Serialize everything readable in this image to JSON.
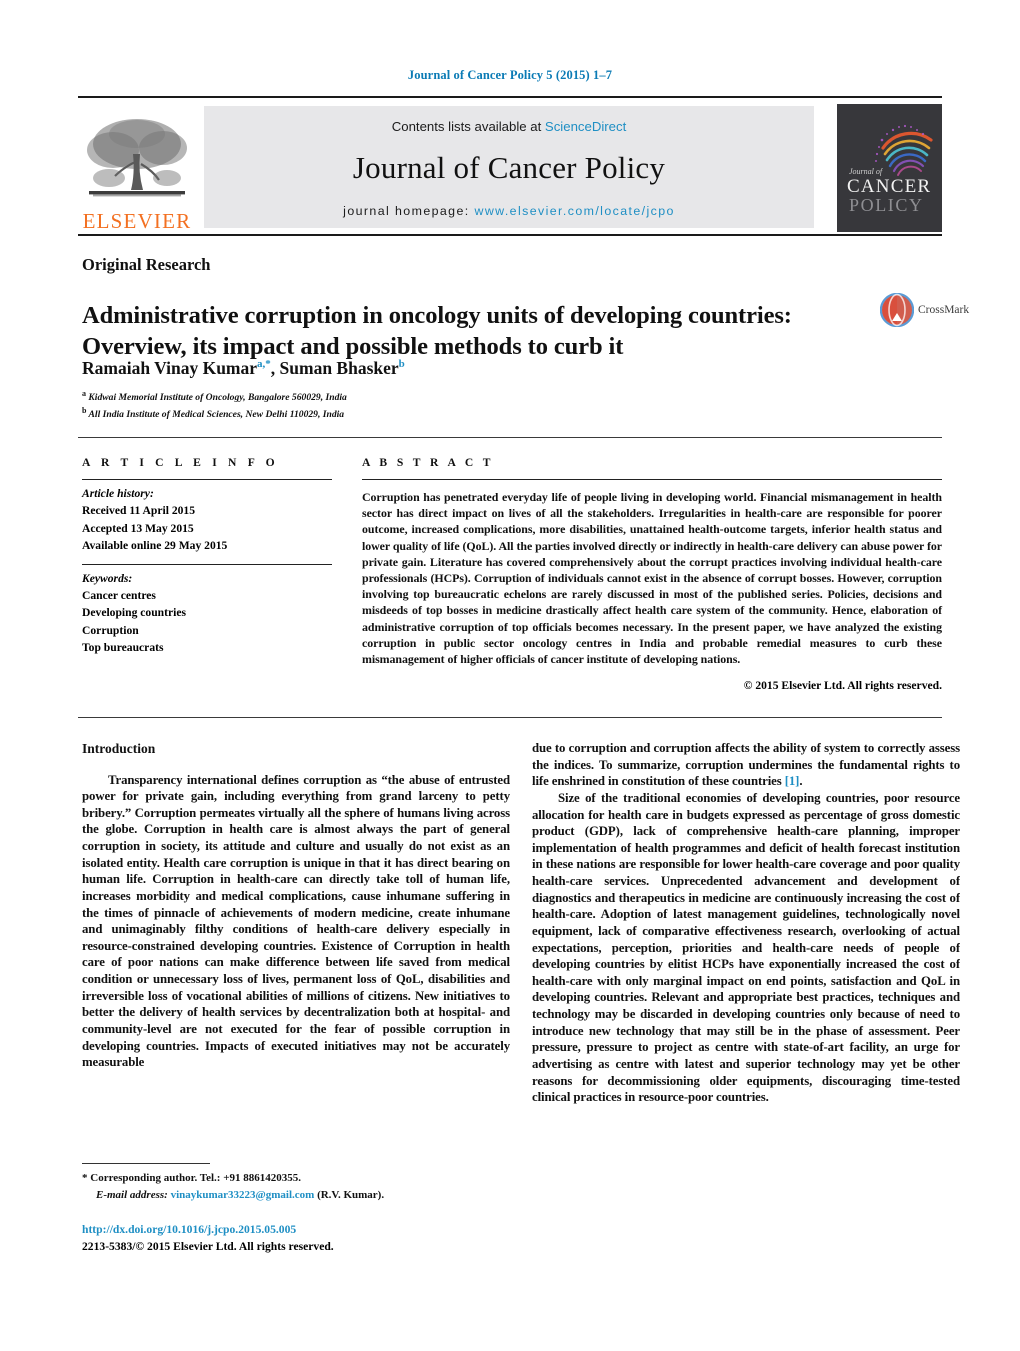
{
  "running_head": "Journal of Cancer Policy 5 (2015) 1–7",
  "masthead": {
    "contents_prefix": "Contents lists available at ",
    "sciencedirect": "ScienceDirect",
    "journal_title": "Journal of Cancer Policy",
    "homepage_prefix": "journal homepage:",
    "homepage_url": "www.elsevier.com/locate/jcpo",
    "publisher_wordmark": "ELSEVIER",
    "cover": {
      "line1": "Journal of",
      "line2": "CANCER",
      "line3": "POLICY"
    }
  },
  "article": {
    "section_type": "Original Research",
    "title": "Administrative corruption in oncology units of developing countries: Overview, its impact and possible methods to curb it",
    "crossmark_label": "CrossMark",
    "authors_html": "Ramaiah Vinay Kumar<sup>a,*</sup>, Suman Bhasker<sup>b</sup>",
    "affiliations": [
      {
        "marker": "a",
        "text": "Kidwai Memorial Institute of Oncology, Bangalore 560029, India"
      },
      {
        "marker": "b",
        "text": "All India Institute of Medical Sciences, New Delhi 110029, India"
      }
    ]
  },
  "article_info": {
    "heading": "A R T I C L E   I N F O",
    "history_label": "Article history:",
    "history": [
      "Received 11 April 2015",
      "Accepted 13 May 2015",
      "Available online 29 May 2015"
    ],
    "keywords_label": "Keywords:",
    "keywords": [
      "Cancer centres",
      "Developing countries",
      "Corruption",
      "Top bureaucrats"
    ]
  },
  "abstract": {
    "heading": "A B S T R A C T",
    "body": "Corruption has penetrated everyday life of people living in developing world. Financial mismanagement in health sector has direct impact on lives of all the stakeholders. Irregularities in health-care are responsible for poorer outcome, increased complications, more disabilities, unattained health-outcome targets, inferior health status and lower quality of life (QoL). All the parties involved directly or indirectly in health-care delivery can abuse power for private gain. Literature has covered comprehensively about the corrupt practices involving individual health-care professionals (HCPs). Corruption of individuals cannot exist in the absence of corrupt bosses. However, corruption involving top bureaucratic echelons are rarely discussed in most of the published series. Policies, decisions and misdeeds of top bosses in medicine drastically affect health care system of the community. Hence, elaboration of administrative corruption of top officials becomes necessary. In the present paper, we have analyzed the existing corruption in public sector oncology centres in India and probable remedial measures to curb these mismanagement of higher officials of cancer institute of developing nations.",
    "copyright": "© 2015 Elsevier Ltd. All rights reserved."
  },
  "body": {
    "intro_heading": "Introduction",
    "left_paragraphs": [
      "Transparency international defines corruption as “the abuse of entrusted power for private gain, including everything from grand larceny to petty bribery.” Corruption permeates virtually all the sphere of humans living across the globe. Corruption in health care is almost always the part of general corruption in society, its attitude and culture and usually do not exist as an isolated entity. Health care corruption is unique in that it has direct bearing on human life. Corruption in health-care can directly take toll of human life, increases morbidity and medical complications, cause inhumane suffering in the times of pinnacle of achievements of modern medicine, create inhumane and unimaginably filthy conditions of health-care delivery especially in resource-constrained developing countries. Existence of Corruption in health care of poor nations can make difference between life saved from medical condition or unnecessary loss of lives, permanent loss of QoL, disabilities and irreversible loss of vocational abilities of millions of citizens. New initiatives to better the delivery of health services by decentralization both at hospital- and community-level are not executed for the fear of possible corruption in developing countries. Impacts of executed initiatives may not be accurately measurable"
    ],
    "right_paragraph_continued": "due to corruption and corruption affects the ability of system to correctly assess the indices. To summarize, corruption undermines the fundamental rights to life enshrined in constitution of these countries ",
    "right_citation": "[1]",
    "right_citation_tail": ".",
    "right_paragraphs": [
      "Size of the traditional economies of developing countries, poor resource allocation for health care in budgets expressed as percentage of gross domestic product (GDP), lack of comprehensive health-care planning, improper implementation of health programmes and deficit of health forecast institution in these nations are responsible for lower health-care coverage and poor quality health-care services. Unprecedented advancement and development of diagnostics and therapeutics in medicine are continuously increasing the cost of health-care. Adoption of latest management guidelines, technologically novel equipment, lack of comparative effectiveness research, overlooking of actual expectations, perception, priorities and health-care needs of people of developing countries by elitist HCPs have exponentially increased the cost of health-care with only marginal impact on end points, satisfaction and QoL in developing countries. Relevant and appropriate best practices, techniques and technology may be discarded in developing countries only because of need to introduce new technology that may still be in the phase of assessment. Peer pressure, pressure to project as centre with state-of-art facility, an urge for advertising as centre with latest and superior technology may yet be other reasons for decommissioning older equipments, discouraging time-tested clinical practices in resource-poor countries."
    ]
  },
  "footnotes": {
    "corresponding": "* Corresponding author. Tel.: +91 8861420355.",
    "email_label": "E-mail address:",
    "email": "vinaykumar33223@gmail.com",
    "email_suffix": " (R.V. Kumar).",
    "doi": "http://dx.doi.org/10.1016/j.jcpo.2015.05.005",
    "issn_line": "2213-5383/© 2015 Elsevier Ltd. All rights reserved."
  },
  "colors": {
    "link": "#1f8fc4",
    "elsevier_orange": "#f37021",
    "cover_bg": "#37373b",
    "band_bg": "#e7e7e9"
  }
}
